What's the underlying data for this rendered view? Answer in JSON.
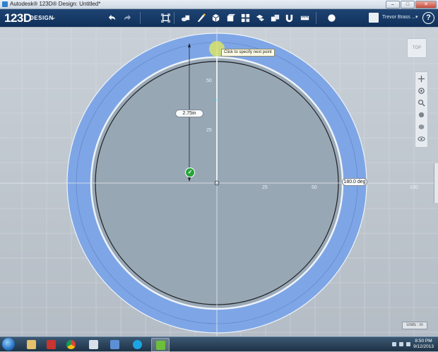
{
  "window": {
    "title": "Autodesk® 123D® Design: Untitled*",
    "buttons": [
      "–",
      "□",
      "✕"
    ]
  },
  "toolbar": {
    "logo": "123D",
    "logo_sub": "DESIGN",
    "tools": [
      "undo-icon",
      "redo-icon",
      "fit-view-icon",
      "primitives-icon",
      "sketch-icon",
      "construct-icon",
      "modify-icon",
      "pattern-icon",
      "group-icon",
      "combine-icon",
      "snap-icon",
      "measure-icon",
      "material-icon"
    ],
    "user_name": "Trevor Brass ...",
    "help_label": "?"
  },
  "canvas": {
    "tooltip": "Click to specify next point",
    "length_input": "2.75in",
    "angle_input": "180.0 deg",
    "confirm_label": "✓",
    "tick_labels": {
      "vertical": [
        "50",
        "25"
      ],
      "horizontal": [
        "25",
        "50",
        "100"
      ]
    },
    "view_cube_label": "TOP",
    "units_label": "Units : in",
    "colors": {
      "ring": "#7ea6e6",
      "disc": "#98a8b6",
      "background": "#c3cad1"
    }
  },
  "navbar": {
    "buttons": [
      "pan-icon",
      "orbit-icon",
      "zoom-icon",
      "fit-icon",
      "view-mode-icon",
      "visibility-icon"
    ]
  },
  "taskbar": {
    "apps": [
      "windows-explorer-icon",
      "file-explorer-icon",
      "solidworks-icon",
      "chrome-icon",
      "remote-desktop-icon",
      "notepad-icon",
      "skype-icon",
      "123d-design-icon"
    ],
    "time": "8:50 PM",
    "date": "9/12/2013"
  }
}
